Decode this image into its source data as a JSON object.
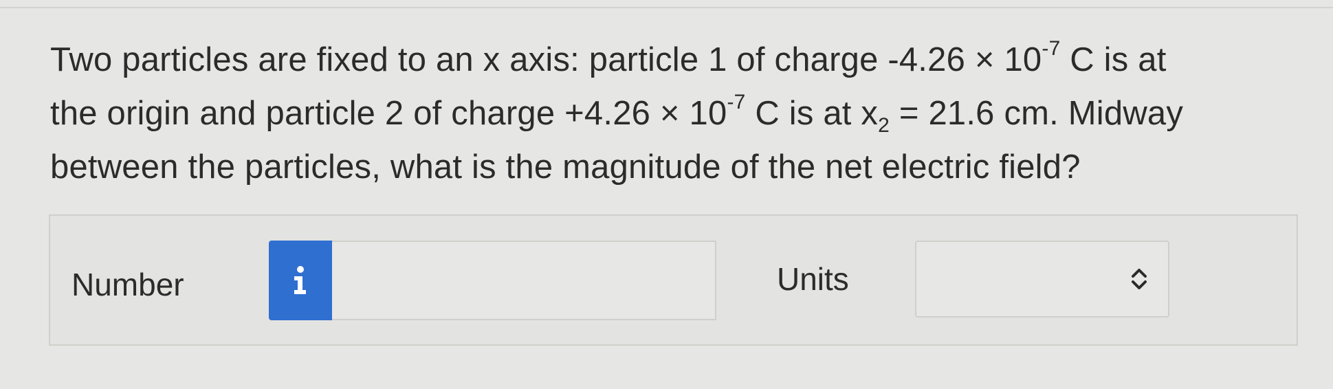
{
  "question": {
    "line1_a": "Two particles are fixed to an x axis: particle 1 of charge -4.26 × 10",
    "line1_exp": "-7",
    "line1_b": " C is at",
    "line2_a": "the origin and particle 2 of charge +4.26 × 10",
    "line2_exp": "-7",
    "line2_b": " C is at x",
    "line2_sub": "2",
    "line2_c": " = 21.6 cm. Midway",
    "line3": "between the particles, what is the magnitude of the net electric field?"
  },
  "answer": {
    "number_label": "Number",
    "number_value": "",
    "info_icon": "info-icon",
    "units_label": "Units",
    "units_value": "",
    "units_icon": "chevron-up-down-icon"
  },
  "colors": {
    "background": "#e6e6e4",
    "info_button": "#2f6fd0",
    "text": "#2b2b2b",
    "border": "#cfcfcc"
  }
}
